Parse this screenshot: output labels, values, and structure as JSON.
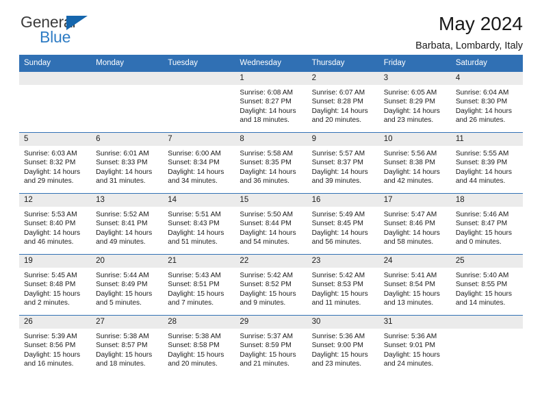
{
  "brand": {
    "name_part1": "General",
    "name_part2": "Blue",
    "triangle_icon": "triangle-icon",
    "color_dark": "#3b3b3b",
    "color_blue": "#2e7cc4",
    "triangle_color": "#1566ad"
  },
  "header": {
    "title": "May 2024",
    "location": "Barbata, Lombardy, Italy"
  },
  "theme": {
    "header_blue": "#3070b4",
    "daynum_gray": "#ebebeb",
    "text": "#1a1a1a"
  },
  "weekdays": [
    "Sunday",
    "Monday",
    "Tuesday",
    "Wednesday",
    "Thursday",
    "Friday",
    "Saturday"
  ],
  "labels": {
    "sunrise": "Sunrise:",
    "sunset": "Sunset:",
    "daylight": "Daylight:"
  },
  "weeks": [
    [
      {
        "day": "",
        "sunrise": "",
        "sunset": "",
        "daylight_line1": "",
        "daylight_line2": ""
      },
      {
        "day": "",
        "sunrise": "",
        "sunset": "",
        "daylight_line1": "",
        "daylight_line2": ""
      },
      {
        "day": "",
        "sunrise": "",
        "sunset": "",
        "daylight_line1": "",
        "daylight_line2": ""
      },
      {
        "day": "1",
        "sunrise": "Sunrise: 6:08 AM",
        "sunset": "Sunset: 8:27 PM",
        "daylight_line1": "Daylight: 14 hours",
        "daylight_line2": "and 18 minutes."
      },
      {
        "day": "2",
        "sunrise": "Sunrise: 6:07 AM",
        "sunset": "Sunset: 8:28 PM",
        "daylight_line1": "Daylight: 14 hours",
        "daylight_line2": "and 20 minutes."
      },
      {
        "day": "3",
        "sunrise": "Sunrise: 6:05 AM",
        "sunset": "Sunset: 8:29 PM",
        "daylight_line1": "Daylight: 14 hours",
        "daylight_line2": "and 23 minutes."
      },
      {
        "day": "4",
        "sunrise": "Sunrise: 6:04 AM",
        "sunset": "Sunset: 8:30 PM",
        "daylight_line1": "Daylight: 14 hours",
        "daylight_line2": "and 26 minutes."
      }
    ],
    [
      {
        "day": "5",
        "sunrise": "Sunrise: 6:03 AM",
        "sunset": "Sunset: 8:32 PM",
        "daylight_line1": "Daylight: 14 hours",
        "daylight_line2": "and 29 minutes."
      },
      {
        "day": "6",
        "sunrise": "Sunrise: 6:01 AM",
        "sunset": "Sunset: 8:33 PM",
        "daylight_line1": "Daylight: 14 hours",
        "daylight_line2": "and 31 minutes."
      },
      {
        "day": "7",
        "sunrise": "Sunrise: 6:00 AM",
        "sunset": "Sunset: 8:34 PM",
        "daylight_line1": "Daylight: 14 hours",
        "daylight_line2": "and 34 minutes."
      },
      {
        "day": "8",
        "sunrise": "Sunrise: 5:58 AM",
        "sunset": "Sunset: 8:35 PM",
        "daylight_line1": "Daylight: 14 hours",
        "daylight_line2": "and 36 minutes."
      },
      {
        "day": "9",
        "sunrise": "Sunrise: 5:57 AM",
        "sunset": "Sunset: 8:37 PM",
        "daylight_line1": "Daylight: 14 hours",
        "daylight_line2": "and 39 minutes."
      },
      {
        "day": "10",
        "sunrise": "Sunrise: 5:56 AM",
        "sunset": "Sunset: 8:38 PM",
        "daylight_line1": "Daylight: 14 hours",
        "daylight_line2": "and 42 minutes."
      },
      {
        "day": "11",
        "sunrise": "Sunrise: 5:55 AM",
        "sunset": "Sunset: 8:39 PM",
        "daylight_line1": "Daylight: 14 hours",
        "daylight_line2": "and 44 minutes."
      }
    ],
    [
      {
        "day": "12",
        "sunrise": "Sunrise: 5:53 AM",
        "sunset": "Sunset: 8:40 PM",
        "daylight_line1": "Daylight: 14 hours",
        "daylight_line2": "and 46 minutes."
      },
      {
        "day": "13",
        "sunrise": "Sunrise: 5:52 AM",
        "sunset": "Sunset: 8:41 PM",
        "daylight_line1": "Daylight: 14 hours",
        "daylight_line2": "and 49 minutes."
      },
      {
        "day": "14",
        "sunrise": "Sunrise: 5:51 AM",
        "sunset": "Sunset: 8:43 PM",
        "daylight_line1": "Daylight: 14 hours",
        "daylight_line2": "and 51 minutes."
      },
      {
        "day": "15",
        "sunrise": "Sunrise: 5:50 AM",
        "sunset": "Sunset: 8:44 PM",
        "daylight_line1": "Daylight: 14 hours",
        "daylight_line2": "and 54 minutes."
      },
      {
        "day": "16",
        "sunrise": "Sunrise: 5:49 AM",
        "sunset": "Sunset: 8:45 PM",
        "daylight_line1": "Daylight: 14 hours",
        "daylight_line2": "and 56 minutes."
      },
      {
        "day": "17",
        "sunrise": "Sunrise: 5:47 AM",
        "sunset": "Sunset: 8:46 PM",
        "daylight_line1": "Daylight: 14 hours",
        "daylight_line2": "and 58 minutes."
      },
      {
        "day": "18",
        "sunrise": "Sunrise: 5:46 AM",
        "sunset": "Sunset: 8:47 PM",
        "daylight_line1": "Daylight: 15 hours",
        "daylight_line2": "and 0 minutes."
      }
    ],
    [
      {
        "day": "19",
        "sunrise": "Sunrise: 5:45 AM",
        "sunset": "Sunset: 8:48 PM",
        "daylight_line1": "Daylight: 15 hours",
        "daylight_line2": "and 2 minutes."
      },
      {
        "day": "20",
        "sunrise": "Sunrise: 5:44 AM",
        "sunset": "Sunset: 8:49 PM",
        "daylight_line1": "Daylight: 15 hours",
        "daylight_line2": "and 5 minutes."
      },
      {
        "day": "21",
        "sunrise": "Sunrise: 5:43 AM",
        "sunset": "Sunset: 8:51 PM",
        "daylight_line1": "Daylight: 15 hours",
        "daylight_line2": "and 7 minutes."
      },
      {
        "day": "22",
        "sunrise": "Sunrise: 5:42 AM",
        "sunset": "Sunset: 8:52 PM",
        "daylight_line1": "Daylight: 15 hours",
        "daylight_line2": "and 9 minutes."
      },
      {
        "day": "23",
        "sunrise": "Sunrise: 5:42 AM",
        "sunset": "Sunset: 8:53 PM",
        "daylight_line1": "Daylight: 15 hours",
        "daylight_line2": "and 11 minutes."
      },
      {
        "day": "24",
        "sunrise": "Sunrise: 5:41 AM",
        "sunset": "Sunset: 8:54 PM",
        "daylight_line1": "Daylight: 15 hours",
        "daylight_line2": "and 13 minutes."
      },
      {
        "day": "25",
        "sunrise": "Sunrise: 5:40 AM",
        "sunset": "Sunset: 8:55 PM",
        "daylight_line1": "Daylight: 15 hours",
        "daylight_line2": "and 14 minutes."
      }
    ],
    [
      {
        "day": "26",
        "sunrise": "Sunrise: 5:39 AM",
        "sunset": "Sunset: 8:56 PM",
        "daylight_line1": "Daylight: 15 hours",
        "daylight_line2": "and 16 minutes."
      },
      {
        "day": "27",
        "sunrise": "Sunrise: 5:38 AM",
        "sunset": "Sunset: 8:57 PM",
        "daylight_line1": "Daylight: 15 hours",
        "daylight_line2": "and 18 minutes."
      },
      {
        "day": "28",
        "sunrise": "Sunrise: 5:38 AM",
        "sunset": "Sunset: 8:58 PM",
        "daylight_line1": "Daylight: 15 hours",
        "daylight_line2": "and 20 minutes."
      },
      {
        "day": "29",
        "sunrise": "Sunrise: 5:37 AM",
        "sunset": "Sunset: 8:59 PM",
        "daylight_line1": "Daylight: 15 hours",
        "daylight_line2": "and 21 minutes."
      },
      {
        "day": "30",
        "sunrise": "Sunrise: 5:36 AM",
        "sunset": "Sunset: 9:00 PM",
        "daylight_line1": "Daylight: 15 hours",
        "daylight_line2": "and 23 minutes."
      },
      {
        "day": "31",
        "sunrise": "Sunrise: 5:36 AM",
        "sunset": "Sunset: 9:01 PM",
        "daylight_line1": "Daylight: 15 hours",
        "daylight_line2": "and 24 minutes."
      },
      {
        "day": "",
        "sunrise": "",
        "sunset": "",
        "daylight_line1": "",
        "daylight_line2": ""
      }
    ]
  ]
}
